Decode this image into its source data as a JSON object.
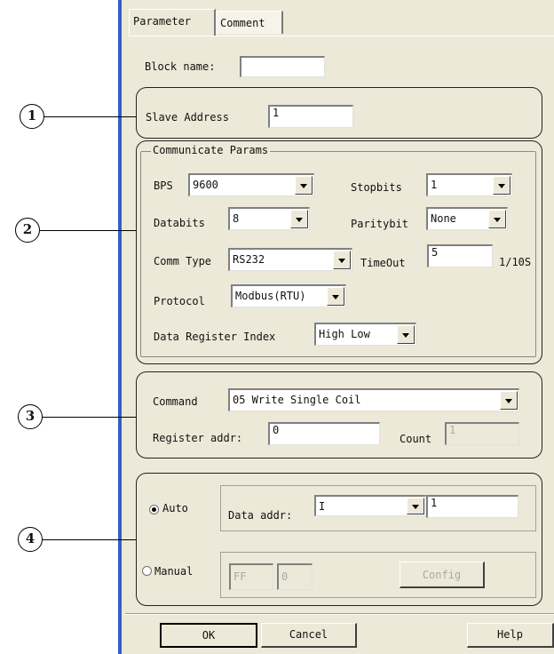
{
  "tabs": [
    {
      "label": "Parameter",
      "active": true
    },
    {
      "label": "Comment",
      "active": false
    }
  ],
  "block_name": {
    "label": "Block name:",
    "value": ""
  },
  "slave": {
    "label": "Slave Address",
    "value": "1"
  },
  "comm": {
    "legend": "Communicate Params",
    "bps": {
      "label": "BPS",
      "value": "9600"
    },
    "stopbits": {
      "label": "Stopbits",
      "value": "1"
    },
    "databits": {
      "label": "Databits",
      "value": "8"
    },
    "paritybit": {
      "label": "Paritybit",
      "value": "None"
    },
    "comm_type": {
      "label": "Comm Type",
      "value": "RS232"
    },
    "timeout": {
      "label": "TimeOut",
      "value": "5",
      "unit": "1/10S"
    },
    "protocol": {
      "label": "Protocol",
      "value": "Modbus(RTU)"
    },
    "data_register_index": {
      "label": "Data Register Index",
      "value": "High Low"
    }
  },
  "command_section": {
    "command_label": "Command",
    "command_value": "05 Write Single Coil",
    "register_label": "Register addr:",
    "register_value": "0",
    "count_label": "Count",
    "count_value": "1"
  },
  "mode": {
    "auto_label": "Auto",
    "auto_selected": true,
    "data_addr_label": "Data addr:",
    "data_addr_type": "I",
    "data_addr_value": "1",
    "manual_label": "Manual",
    "manual_selected": false,
    "manual_field1": "FF",
    "manual_field2": "0",
    "config_label": "Config"
  },
  "buttons": {
    "ok": "OK",
    "cancel": "Cancel",
    "help": "Help"
  },
  "callouts": [
    "1",
    "2",
    "3",
    "4"
  ],
  "colors": {
    "dialog_bg": "#ece9d8",
    "accent_blue": "#2f5fcf"
  }
}
